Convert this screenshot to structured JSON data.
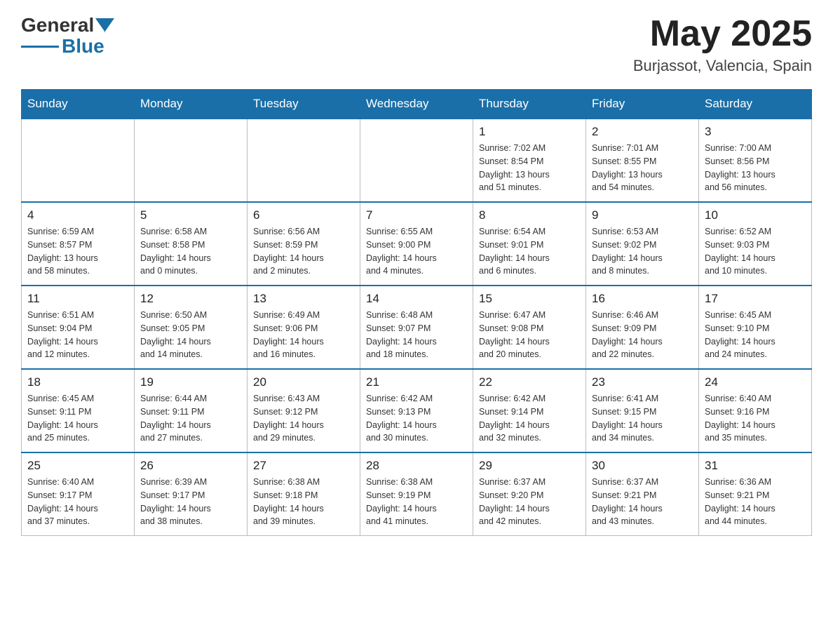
{
  "header": {
    "logo_general": "General",
    "logo_blue": "Blue",
    "title": "May 2025",
    "location": "Burjassot, Valencia, Spain"
  },
  "days_of_week": [
    "Sunday",
    "Monday",
    "Tuesday",
    "Wednesday",
    "Thursday",
    "Friday",
    "Saturday"
  ],
  "weeks": [
    [
      {
        "day": "",
        "info": ""
      },
      {
        "day": "",
        "info": ""
      },
      {
        "day": "",
        "info": ""
      },
      {
        "day": "",
        "info": ""
      },
      {
        "day": "1",
        "info": "Sunrise: 7:02 AM\nSunset: 8:54 PM\nDaylight: 13 hours\nand 51 minutes."
      },
      {
        "day": "2",
        "info": "Sunrise: 7:01 AM\nSunset: 8:55 PM\nDaylight: 13 hours\nand 54 minutes."
      },
      {
        "day": "3",
        "info": "Sunrise: 7:00 AM\nSunset: 8:56 PM\nDaylight: 13 hours\nand 56 minutes."
      }
    ],
    [
      {
        "day": "4",
        "info": "Sunrise: 6:59 AM\nSunset: 8:57 PM\nDaylight: 13 hours\nand 58 minutes."
      },
      {
        "day": "5",
        "info": "Sunrise: 6:58 AM\nSunset: 8:58 PM\nDaylight: 14 hours\nand 0 minutes."
      },
      {
        "day": "6",
        "info": "Sunrise: 6:56 AM\nSunset: 8:59 PM\nDaylight: 14 hours\nand 2 minutes."
      },
      {
        "day": "7",
        "info": "Sunrise: 6:55 AM\nSunset: 9:00 PM\nDaylight: 14 hours\nand 4 minutes."
      },
      {
        "day": "8",
        "info": "Sunrise: 6:54 AM\nSunset: 9:01 PM\nDaylight: 14 hours\nand 6 minutes."
      },
      {
        "day": "9",
        "info": "Sunrise: 6:53 AM\nSunset: 9:02 PM\nDaylight: 14 hours\nand 8 minutes."
      },
      {
        "day": "10",
        "info": "Sunrise: 6:52 AM\nSunset: 9:03 PM\nDaylight: 14 hours\nand 10 minutes."
      }
    ],
    [
      {
        "day": "11",
        "info": "Sunrise: 6:51 AM\nSunset: 9:04 PM\nDaylight: 14 hours\nand 12 minutes."
      },
      {
        "day": "12",
        "info": "Sunrise: 6:50 AM\nSunset: 9:05 PM\nDaylight: 14 hours\nand 14 minutes."
      },
      {
        "day": "13",
        "info": "Sunrise: 6:49 AM\nSunset: 9:06 PM\nDaylight: 14 hours\nand 16 minutes."
      },
      {
        "day": "14",
        "info": "Sunrise: 6:48 AM\nSunset: 9:07 PM\nDaylight: 14 hours\nand 18 minutes."
      },
      {
        "day": "15",
        "info": "Sunrise: 6:47 AM\nSunset: 9:08 PM\nDaylight: 14 hours\nand 20 minutes."
      },
      {
        "day": "16",
        "info": "Sunrise: 6:46 AM\nSunset: 9:09 PM\nDaylight: 14 hours\nand 22 minutes."
      },
      {
        "day": "17",
        "info": "Sunrise: 6:45 AM\nSunset: 9:10 PM\nDaylight: 14 hours\nand 24 minutes."
      }
    ],
    [
      {
        "day": "18",
        "info": "Sunrise: 6:45 AM\nSunset: 9:11 PM\nDaylight: 14 hours\nand 25 minutes."
      },
      {
        "day": "19",
        "info": "Sunrise: 6:44 AM\nSunset: 9:11 PM\nDaylight: 14 hours\nand 27 minutes."
      },
      {
        "day": "20",
        "info": "Sunrise: 6:43 AM\nSunset: 9:12 PM\nDaylight: 14 hours\nand 29 minutes."
      },
      {
        "day": "21",
        "info": "Sunrise: 6:42 AM\nSunset: 9:13 PM\nDaylight: 14 hours\nand 30 minutes."
      },
      {
        "day": "22",
        "info": "Sunrise: 6:42 AM\nSunset: 9:14 PM\nDaylight: 14 hours\nand 32 minutes."
      },
      {
        "day": "23",
        "info": "Sunrise: 6:41 AM\nSunset: 9:15 PM\nDaylight: 14 hours\nand 34 minutes."
      },
      {
        "day": "24",
        "info": "Sunrise: 6:40 AM\nSunset: 9:16 PM\nDaylight: 14 hours\nand 35 minutes."
      }
    ],
    [
      {
        "day": "25",
        "info": "Sunrise: 6:40 AM\nSunset: 9:17 PM\nDaylight: 14 hours\nand 37 minutes."
      },
      {
        "day": "26",
        "info": "Sunrise: 6:39 AM\nSunset: 9:17 PM\nDaylight: 14 hours\nand 38 minutes."
      },
      {
        "day": "27",
        "info": "Sunrise: 6:38 AM\nSunset: 9:18 PM\nDaylight: 14 hours\nand 39 minutes."
      },
      {
        "day": "28",
        "info": "Sunrise: 6:38 AM\nSunset: 9:19 PM\nDaylight: 14 hours\nand 41 minutes."
      },
      {
        "day": "29",
        "info": "Sunrise: 6:37 AM\nSunset: 9:20 PM\nDaylight: 14 hours\nand 42 minutes."
      },
      {
        "day": "30",
        "info": "Sunrise: 6:37 AM\nSunset: 9:21 PM\nDaylight: 14 hours\nand 43 minutes."
      },
      {
        "day": "31",
        "info": "Sunrise: 6:36 AM\nSunset: 9:21 PM\nDaylight: 14 hours\nand 44 minutes."
      }
    ]
  ]
}
